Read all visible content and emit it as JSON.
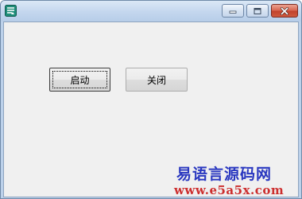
{
  "window": {
    "title": ""
  },
  "buttons": {
    "start_label": "启动",
    "close_label": "关闭"
  },
  "watermark": {
    "site_name": "易语言源码网",
    "site_url": "www.e5a5x.com"
  },
  "colors": {
    "titlebar": "#c3d6ee",
    "client": "#f0f0f0",
    "close_button": "#c2432d",
    "watermark_name": "#2a38c0",
    "watermark_url": "#cc2e2e"
  },
  "icons": {
    "app": "app-icon",
    "minimize": "minimize-icon",
    "maximize": "maximize-icon",
    "close": "close-icon"
  }
}
